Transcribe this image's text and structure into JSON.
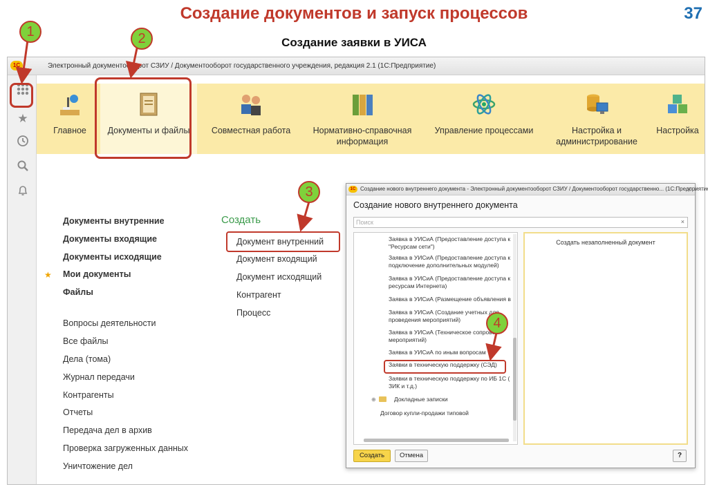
{
  "slide": {
    "title": "Создание документов и запуск процессов",
    "page_number": "37",
    "subtitle": "Создание заявки в УИСА"
  },
  "window": {
    "logo": "1С",
    "title": "Электронный документооборот СЗИУ / Документооборот государственного учреждения, редакция 2.1  (1С:Предприятие)"
  },
  "toolbar_icons": [
    "apps-grid-icon",
    "star-icon",
    "history-icon",
    "search-icon",
    "bell-icon"
  ],
  "sections": [
    {
      "label": "Главное",
      "icon": "home-lamp-icon"
    },
    {
      "label": "Документы и файлы",
      "icon": "folder-documents-icon"
    },
    {
      "label": "Совместная работа",
      "icon": "people-icon"
    },
    {
      "label": "Нормативно-справочная информация",
      "icon": "binders-icon"
    },
    {
      "label": "Управление процессами",
      "icon": "process-atom-icon"
    },
    {
      "label": "Настройка и администрирование",
      "icon": "database-monitor-icon"
    },
    {
      "label": "Настройка",
      "icon": "cubes-icon"
    }
  ],
  "nav": {
    "bold_links": [
      "Документы внутренние",
      "Документы входящие",
      "Документы исходящие",
      "Мои документы",
      "Файлы"
    ],
    "links": [
      "Вопросы деятельности",
      "Все файлы",
      "Дела (тома)",
      "Журнал передачи",
      "Контрагенты",
      "Отчеты",
      "Передача дел в архив",
      "Проверка загруженных данных",
      "Уничтожение дел"
    ]
  },
  "create": {
    "title": "Создать",
    "links": [
      "Документ внутренний",
      "Документ входящий",
      "Документ исходящий",
      "Контрагент",
      "Процесс"
    ]
  },
  "dialog": {
    "title": "Создание нового внутреннего документа - Электронный документооборот СЗИУ / Документооборот государственно... (1С:Предприятие)",
    "close": "×",
    "heading": "Создание нового внутреннего документа",
    "search_placeholder": "Поиск",
    "search_clear": "×",
    "items": [
      "Заявка в УИСиА (Предоставление доступа к \"Ресурсам сети\")",
      "Заявка в УИСиА (Предоставление доступа к подключение дополнительных модулей)",
      "Заявка в УИСиА (Предоставление доступа к ресурсам Интернета)",
      "Заявка в УИСиА (Размещение объявления в",
      "Заявка в УИСиА (Создание учетных для проведения мероприятий)",
      "Заявка в УИСиА (Техническое сопрово мероприятий)",
      "Заявка в УИСиА по иным вопросам",
      "Заявки в техническую поддержку (СЭД)",
      "Заявки в техническую поддержку по ИБ 1С ( ЗИК и т.д.)"
    ],
    "folder": "Докладные записки",
    "contract": "Договор купли-продажи типовой",
    "preview": "Создать незаполненный документ",
    "btn_create": "Создать",
    "btn_cancel": "Отмена",
    "btn_help": "?"
  },
  "annotations": [
    "1",
    "2",
    "3",
    "4"
  ],
  "colors": {
    "accent_red": "#c0392b",
    "badge_green": "#7fd13b",
    "section_band": "#fbeaa8",
    "create_green": "#3a9a4a",
    "title_blue": "#1f6fb2"
  }
}
